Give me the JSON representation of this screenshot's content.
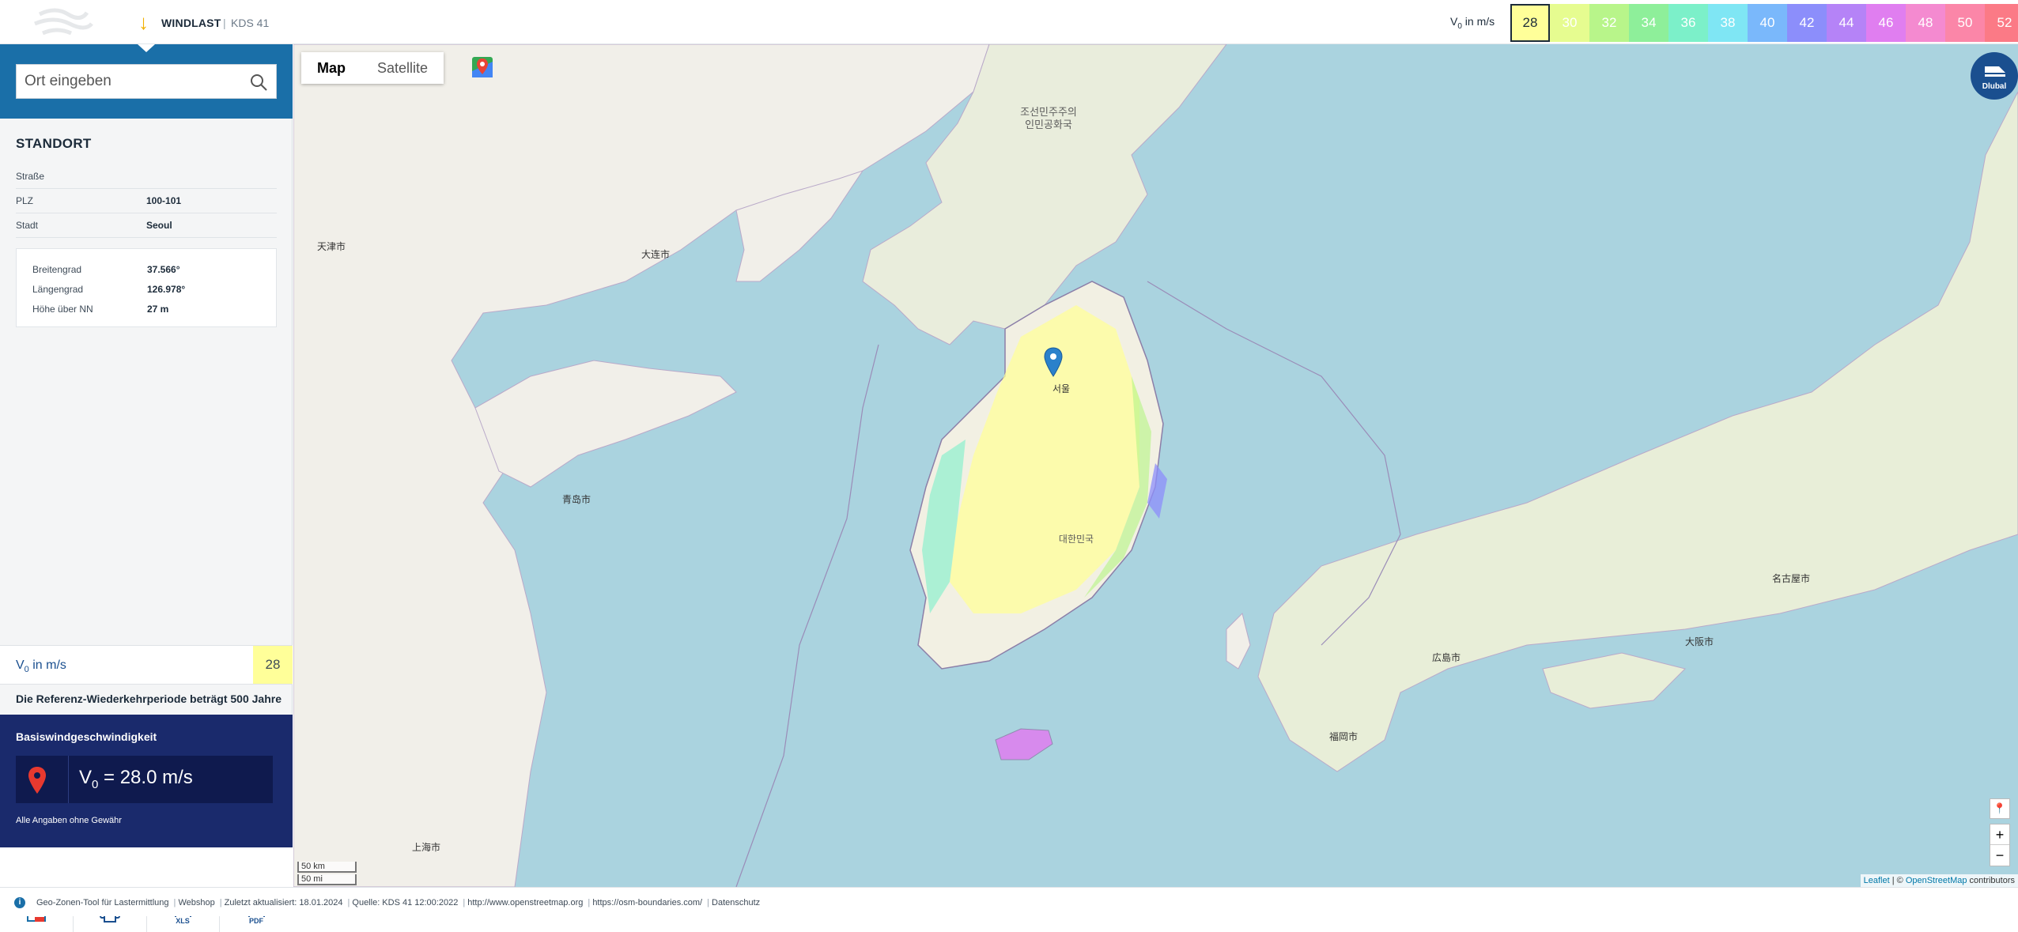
{
  "header": {
    "app_title": "WINDLAST",
    "separator": "|",
    "standard": "KDS 41",
    "legend_label": "V0 in m/s",
    "legend": [
      {
        "value": "28",
        "color": "#ffff99",
        "active": true
      },
      {
        "value": "30",
        "color": "#e6fc90"
      },
      {
        "value": "32",
        "color": "#b8f58a"
      },
      {
        "value": "34",
        "color": "#8eef9a"
      },
      {
        "value": "36",
        "color": "#7cf0c9"
      },
      {
        "value": "38",
        "color": "#7fe6f4"
      },
      {
        "value": "40",
        "color": "#7ab8fb"
      },
      {
        "value": "42",
        "color": "#8c8efb"
      },
      {
        "value": "44",
        "color": "#b583f7"
      },
      {
        "value": "46",
        "color": "#e07ef0"
      },
      {
        "value": "48",
        "color": "#f48ad0"
      },
      {
        "value": "50",
        "color": "#fb86a8"
      },
      {
        "value": "52",
        "color": "#fb7a86"
      }
    ]
  },
  "sidebar": {
    "search": {
      "placeholder": "Ort eingeben",
      "value": ""
    },
    "location_title": "STANDORT",
    "fields": [
      {
        "label": "Straße",
        "value": ""
      },
      {
        "label": "PLZ",
        "value": "100-101"
      },
      {
        "label": "Stadt",
        "value": "Seoul"
      }
    ],
    "coords": [
      {
        "label": "Breitengrad",
        "value": "37.566°"
      },
      {
        "label": "Längengrad",
        "value": "126.978°"
      },
      {
        "label": "Höhe über NN",
        "value": "27 m"
      }
    ],
    "v0_label": "V",
    "v0_sub": "0",
    "v0_unit": " in m/s",
    "v0_value": "28",
    "reference_note": "Die Referenz-Wiederkehrperiode beträgt 500 Jahre",
    "basis": {
      "heading": "Basiswindgeschwindigkeit",
      "formula_v": "V",
      "formula_sub": "0",
      "formula_rest": " = 28.0 m/s",
      "disclaimer": "Alle Angaben ohne Gewähr"
    },
    "tools": [
      {
        "name": "wind-map-tool",
        "label": ""
      },
      {
        "name": "print-tool",
        "label": ""
      },
      {
        "name": "xls-export",
        "label": "XLS"
      },
      {
        "name": "pdf-export",
        "label": "PDF"
      }
    ]
  },
  "map": {
    "type_map": "Map",
    "type_satellite": "Satellite",
    "dlubal_label": "Dlubal",
    "zoom_in": "+",
    "zoom_out": "−",
    "scale_km": "50 km",
    "scale_mi": "50 mi",
    "attribution_leaflet": "Leaflet",
    "attribution_sep": " | © ",
    "attribution_osm": "OpenStreetMap",
    "attribution_rest": " contributors",
    "labels": {
      "north_korea": "조선민주주의\n인민공화국",
      "south_korea": "대한민국",
      "japan_city_1": "福岡市",
      "japan_city_2": "広島市",
      "japan_city_3": "大阪市",
      "japan_city_4": "名古屋市",
      "china_city_1": "青岛市",
      "china_city_2": "大连市",
      "china_city_3": "天津市",
      "china_city_4": "上海市",
      "seoul": "서울"
    }
  },
  "footer": {
    "items": [
      "Geo-Zonen-Tool für Lastermittlung",
      "Webshop",
      "Zuletzt aktualisiert: 18.01.2024",
      "Quelle: KDS 41 12:00:2022",
      "http://www.openstreetmap.org",
      "https://osm-boundaries.com/",
      "Datenschutz"
    ]
  }
}
